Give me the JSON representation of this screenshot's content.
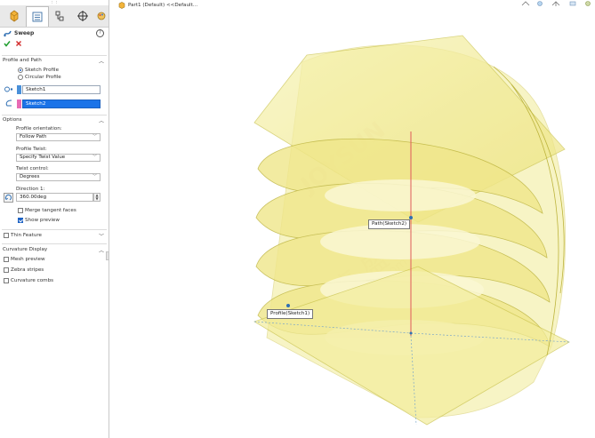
{
  "feature": {
    "title": "Sweep",
    "help_icon": "help-icon",
    "ok_icon": "check-icon",
    "cancel_icon": "x-icon"
  },
  "tabs": [
    {
      "name": "feature-manager-icon"
    },
    {
      "name": "property-manager-icon"
    },
    {
      "name": "configuration-manager-icon"
    },
    {
      "name": "dimxpert-manager-icon"
    },
    {
      "name": "display-manager-icon"
    }
  ],
  "profile_path": {
    "title": "Profile and Path",
    "radio_sketch": "Sketch Profile",
    "radio_circular": "Circular Profile",
    "profile_value": "Sketch1",
    "path_value": "Sketch2",
    "profile_color": "#4a90d9",
    "path_color": "#e86bb5"
  },
  "options": {
    "title": "Options",
    "orientation_label": "Profile orientation:",
    "orientation_value": "Follow Path",
    "twist_label": "Profile Twist:",
    "twist_value": "Specify Twist Value",
    "twist_control_label": "Twist control:",
    "twist_control_value": "Degrees",
    "direction_label": "Direction 1:",
    "direction_value": "360.00deg",
    "merge_label": "Merge tangent faces",
    "preview_label": "Show preview"
  },
  "thin_feature": {
    "title": "Thin Feature"
  },
  "curvature": {
    "title": "Curvature Display",
    "mesh": "Mesh preview",
    "zebra": "Zebra stripes",
    "combs": "Curvature combs"
  },
  "graphics": {
    "breadcrumb": "Part1 (Default) <<Default...",
    "path_tag": "Path(Sketch2)",
    "profile_tag": "Profile(Sketch1)"
  },
  "colors": {
    "selected": "#1a73e8",
    "sweep_fill": "#f4ef9c",
    "sweep_edge": "#c9c24a",
    "path_line": "#e05a5a"
  }
}
